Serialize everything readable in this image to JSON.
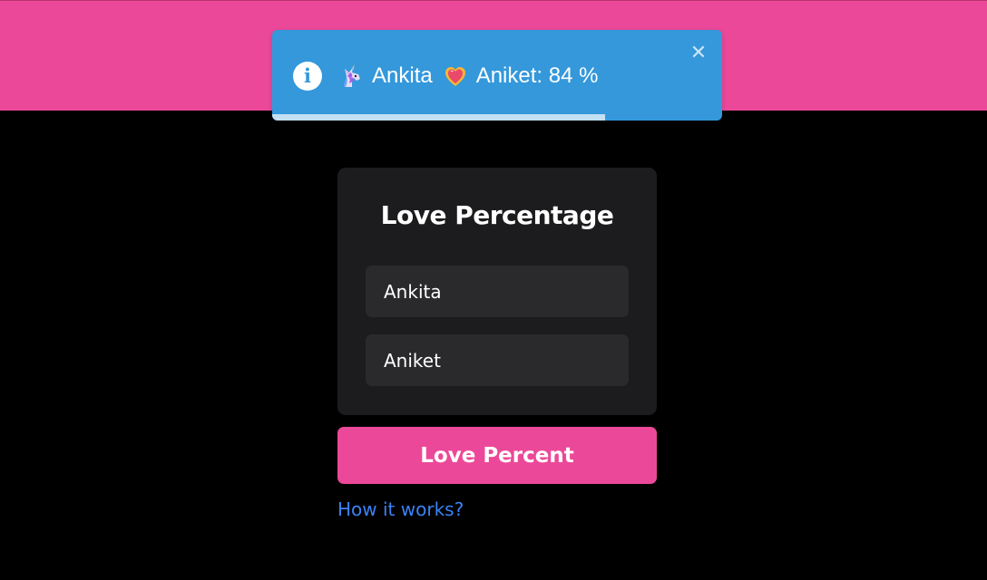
{
  "colors": {
    "accent": "#ec4899",
    "toast_bg": "#3498db",
    "page_bg": "#000000",
    "card_bg": "#1c1c1e",
    "input_bg": "#2a2a2d",
    "link": "#3b82f6"
  },
  "toast": {
    "icon": "info-icon",
    "emoji_a": "unicorn-emoji",
    "name_a": "Ankita",
    "emoji_b": "sparkling-heart-emoji",
    "result_text": "Aniket: 84 %",
    "close_icon": "close-icon",
    "progress_remaining": 0.74
  },
  "card": {
    "title": "Love Percentage",
    "first_name_value": "Ankita",
    "second_name_value": "Aniket"
  },
  "actions": {
    "submit_label": "Love Percent",
    "help_link": "How it works?"
  }
}
